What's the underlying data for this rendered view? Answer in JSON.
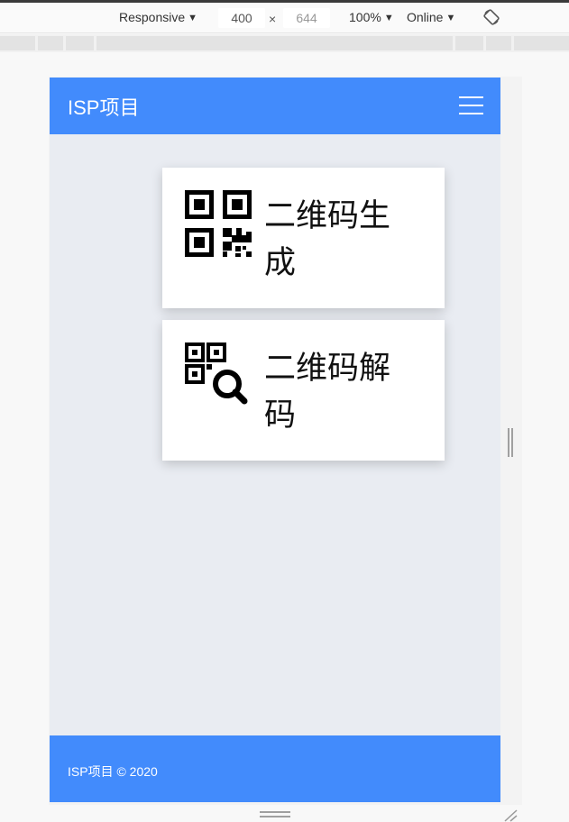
{
  "devtools": {
    "device": "Responsive",
    "width": "400",
    "times": "×",
    "height": "644",
    "zoom": "100%",
    "network": "Online",
    "rotate_icon": "rotate-icon"
  },
  "app": {
    "brand": "ISP项目",
    "menu_icon": "hamburger-menu-icon",
    "cards": [
      {
        "label": "二维码生成",
        "icon": "qr-code-icon"
      },
      {
        "label": "二维码解码",
        "icon": "qr-search-icon"
      }
    ],
    "footer": "ISP项目 © 2020",
    "colors": {
      "primary": "#428bfc",
      "background": "#e9ecf2",
      "card": "#ffffff"
    }
  }
}
